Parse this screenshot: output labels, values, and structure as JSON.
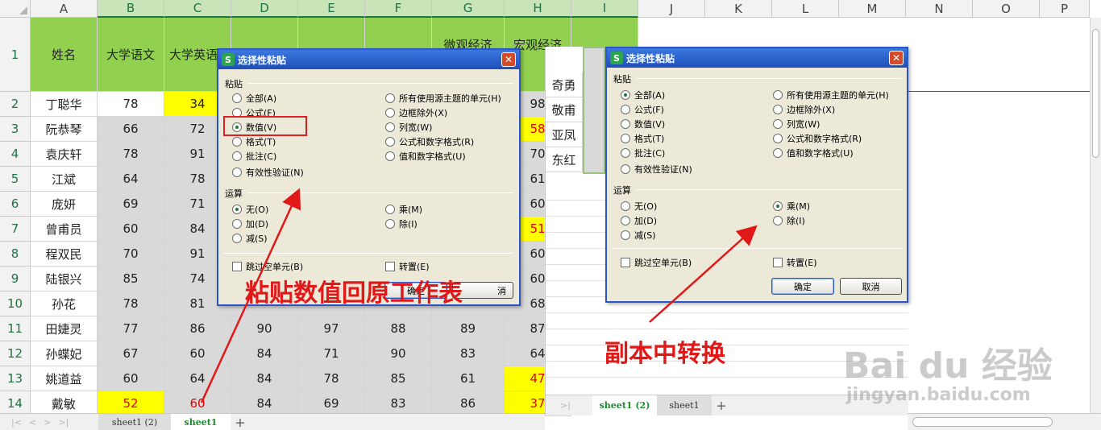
{
  "columns": [
    "A",
    "B",
    "C",
    "D",
    "E",
    "F",
    "G",
    "H",
    "I",
    "J",
    "K",
    "L",
    "M",
    "N",
    "O",
    "P"
  ],
  "row_numbers": [
    "1",
    "2",
    "3",
    "4",
    "5",
    "6",
    "7",
    "8",
    "9",
    "10",
    "11",
    "12",
    "13",
    "14"
  ],
  "headers": {
    "name": "姓名",
    "chinese": "大学语文",
    "english": "大学英语",
    "micro": "微观经济",
    "macro": "宏观经济",
    "macro_tail": "学"
  },
  "rows": [
    {
      "name": "丁聪华",
      "b": "78",
      "c": "34",
      "h": "98"
    },
    {
      "name": "阮恭琴",
      "b": "66",
      "c": "72",
      "h": "58"
    },
    {
      "name": "袁庆轩",
      "b": "78",
      "c": "91",
      "h": "70"
    },
    {
      "name": "江斌",
      "b": "64",
      "c": "78",
      "h": "61"
    },
    {
      "name": "庞妍",
      "b": "69",
      "c": "71",
      "h": "60"
    },
    {
      "name": "曾甫员",
      "b": "60",
      "c": "84",
      "h": "51"
    },
    {
      "name": "程双民",
      "b": "70",
      "c": "91",
      "h": "60"
    },
    {
      "name": "陆银兴",
      "b": "85",
      "c": "74",
      "h": "60"
    },
    {
      "name": "孙花",
      "b": "78",
      "c": "81",
      "d": "",
      "e": "",
      "f": "",
      "g": "",
      "h": "68"
    },
    {
      "name": "田婕灵",
      "b": "77",
      "c": "86",
      "d": "90",
      "e": "97",
      "f": "88",
      "g": "89",
      "h": "87"
    },
    {
      "name": "孙蝶妃",
      "b": "67",
      "c": "60",
      "d": "84",
      "e": "71",
      "f": "90",
      "g": "83",
      "h": "64"
    },
    {
      "name": "姚道益",
      "b": "60",
      "c": "64",
      "d": "84",
      "e": "78",
      "f": "85",
      "g": "61",
      "h": "47"
    },
    {
      "name": "戴敏",
      "b": "52",
      "c": "60",
      "d": "84",
      "e": "69",
      "f": "83",
      "g": "86",
      "h": "37"
    }
  ],
  "right_sheet_names": [
    "奇勇",
    "敬甫",
    "亚凤",
    "东红"
  ],
  "dialog": {
    "title": "选择性粘贴",
    "app_icon": "S",
    "close": "✕",
    "paste_section": "粘贴",
    "paste_left": [
      "全部(A)",
      "公式(F)",
      "数值(V)",
      "格式(T)",
      "批注(C)",
      "有效性验证(N)"
    ],
    "paste_right": [
      "所有使用源主题的单元(H)",
      "边框除外(X)",
      "列宽(W)",
      "公式和数字格式(R)",
      "值和数字格式(U)"
    ],
    "op_section": "运算",
    "op_left": [
      "无(O)",
      "加(D)",
      "减(S)"
    ],
    "op_right": [
      "乘(M)",
      "除(I)"
    ],
    "skip_blanks": "跳过空单元(B)",
    "transpose": "转置(E)",
    "ok": "确定",
    "cancel": "取消",
    "cancel_partial": "消"
  },
  "tabs": {
    "left_inactive": "sheet1 (2)",
    "left_active": "sheet1",
    "right_active": "sheet1 (2)",
    "right_inactive": "sheet1",
    "add": "+",
    "nav": [
      "|<",
      "<",
      ">",
      ">|"
    ],
    "right_nav": ">|"
  },
  "captions": {
    "left": "粘贴数值回原工作表",
    "right": "副本中转换"
  },
  "watermark": {
    "logo": "Bai du 经验",
    "url": "jingyan.baidu.com"
  },
  "colors": {
    "header_green": "#92d050",
    "cell_gray": "#d9d9d9",
    "highlight_yellow": "#ffff00",
    "annotation_red": "#e01818",
    "dialog_blue": "#2a55c8"
  }
}
